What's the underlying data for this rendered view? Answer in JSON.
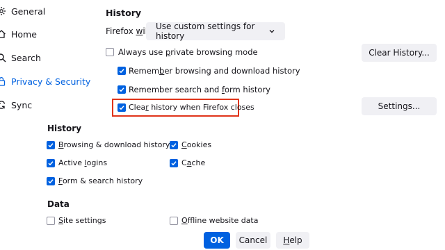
{
  "sidebar": {
    "items": [
      {
        "label": "General",
        "icon": "gear-icon",
        "active": false
      },
      {
        "label": "Home",
        "icon": "home-icon",
        "active": false
      },
      {
        "label": "Search",
        "icon": "search-icon",
        "active": false
      },
      {
        "label": "Privacy & Security",
        "icon": "lock-icon",
        "active": true
      },
      {
        "label": "Sync",
        "icon": "sync-icon",
        "active": false
      }
    ]
  },
  "history": {
    "title": "History",
    "firefox_will_prefix": "Firefox ",
    "firefox_will_underlined": "w",
    "firefox_will_suffix": "ill",
    "mode_select": "Use custom settings for history",
    "clear_history_button": "Clear History...",
    "settings_button": "Settings...",
    "options": {
      "private_mode": {
        "pre": "Always use ",
        "u": "p",
        "post": "rivate browsing mode",
        "checked": false
      },
      "remember_browsing": {
        "pre": "Remem",
        "u": "b",
        "post": "er browsing and download history",
        "checked": true
      },
      "remember_search": {
        "pre": "Remember search and ",
        "u": "f",
        "post": "orm history",
        "checked": true
      },
      "clear_on_close": {
        "pre": "Clea",
        "u": "r",
        "post": " history when Firefox closes",
        "checked": true
      }
    }
  },
  "dialog": {
    "history_title": "History",
    "data_title": "Data",
    "items": {
      "browsing_download": {
        "u": "B",
        "post": "rowsing & download history",
        "checked": true
      },
      "cookies": {
        "u": "C",
        "post": "ookies",
        "checked": true
      },
      "active_logins": {
        "pre": "Active ",
        "u": "l",
        "post": "ogins",
        "checked": true
      },
      "cache": {
        "pre": "C",
        "u": "a",
        "post": "che",
        "checked": true
      },
      "form_search": {
        "u": "F",
        "post": "orm & search history",
        "checked": true
      },
      "site_settings": {
        "u": "S",
        "post": "ite settings",
        "checked": false
      },
      "offline_data": {
        "u": "O",
        "post": "ffline website data",
        "checked": false
      }
    },
    "ok_label": "OK",
    "cancel_label": "Cancel",
    "help_label": "Help",
    "help_underlined": "H",
    "help_rest": "elp"
  },
  "colors": {
    "accent": "#0061e0",
    "highlight": "#e0341a",
    "button_bg": "#f0f0f4"
  }
}
